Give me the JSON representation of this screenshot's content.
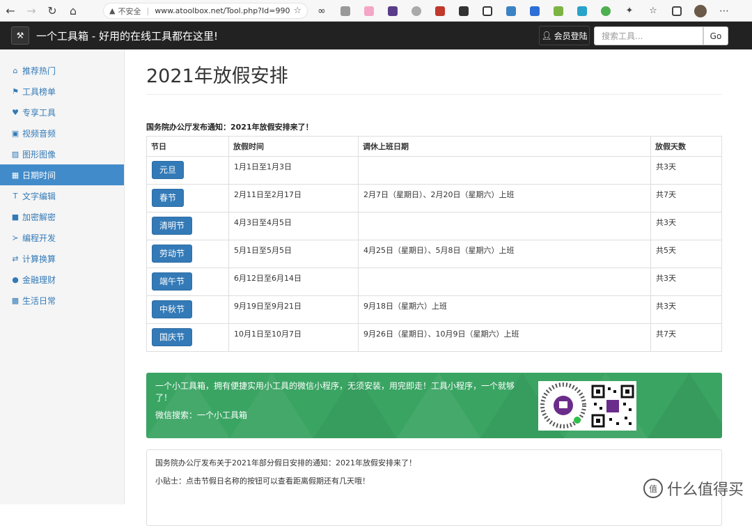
{
  "browser": {
    "security_label": "不安全",
    "url": "www.atoolbox.net/Tool.php?Id=990"
  },
  "site": {
    "brand": "一个工具箱 - 好用的在线工具都在这里!",
    "login_label": "会员登陆",
    "search_placeholder": "搜索工具...",
    "go_label": "Go"
  },
  "sidebar": {
    "items": [
      {
        "icon": "home-icon",
        "label": "推荐热门"
      },
      {
        "icon": "flag-icon",
        "label": "工具榜单"
      },
      {
        "icon": "heart-icon",
        "label": "专享工具"
      },
      {
        "icon": "film-icon",
        "label": "视频音频"
      },
      {
        "icon": "picture-icon",
        "label": "图形图像"
      },
      {
        "icon": "calendar-icon",
        "label": "日期时间"
      },
      {
        "icon": "text-icon",
        "label": "文字编辑"
      },
      {
        "icon": "lock-icon",
        "label": "加密解密"
      },
      {
        "icon": "console-icon",
        "label": "编程开发"
      },
      {
        "icon": "transfer-icon",
        "label": "计算换算"
      },
      {
        "icon": "piggy-bank-icon",
        "label": "金融理财"
      },
      {
        "icon": "qrcode-icon",
        "label": "生活日常"
      }
    ],
    "active_index": 5
  },
  "main": {
    "title": "2021年放假安排",
    "notice": "国务院办公厅发布通知：2021年放假安排来了！",
    "table": {
      "headers": [
        "节日",
        "放假时间",
        "调休上班日期",
        "放假天数"
      ],
      "rows": [
        {
          "holiday": "元旦",
          "period": "1月1日至1月3日",
          "workdays": "",
          "days": "共3天"
        },
        {
          "holiday": "春节",
          "period": "2月11日至2月17日",
          "workdays": "2月7日（星期日）、2月20日（星期六）上班",
          "days": "共7天"
        },
        {
          "holiday": "清明节",
          "period": "4月3日至4月5日",
          "workdays": "",
          "days": "共3天"
        },
        {
          "holiday": "劳动节",
          "period": "5月1日至5月5日",
          "workdays": "4月25日（星期日）、5月8日（星期六）上班",
          "days": "共5天"
        },
        {
          "holiday": "端午节",
          "period": "6月12日至6月14日",
          "workdays": "",
          "days": "共3天"
        },
        {
          "holiday": "中秋节",
          "period": "9月19日至9月21日",
          "workdays": "9月18日（星期六）上班",
          "days": "共3天"
        },
        {
          "holiday": "国庆节",
          "period": "10月1日至10月7日",
          "workdays": "9月26日（星期日）、10月9日（星期六）上班",
          "days": "共7天"
        }
      ]
    },
    "promo": {
      "text": "一个小工具箱，拥有便捷实用小工具的微信小程序，无须安装，用完即走！工具小程序，一个就够了！",
      "search_text": "微信搜索：一个小工具箱",
      "color": "#3aa463"
    },
    "info": {
      "line1": "国务院办公厅发布关于2021年部分假日安排的通知：2021年放假安排来了！",
      "line2": "小贴士：点击节假日名称的按钮可以查看距离假期还有几天哦！"
    }
  },
  "watermark": {
    "icon": "值",
    "text": "什么值得买"
  }
}
